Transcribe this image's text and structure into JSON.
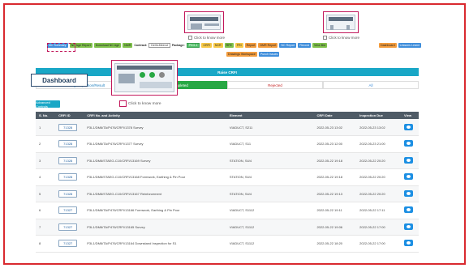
{
  "notes": {
    "click_to_know_more": "Click to know more"
  },
  "callout_label": "Dashboard",
  "toolbar": {
    "buttons_left": [
      "NC Summary",
      "NC Age Report",
      "Download NC Age",
      "NMR"
    ],
    "contract_label": "Contract:",
    "contract_value": "Delhi-Meerut",
    "package_label": "Package:",
    "package_value": "PKG-1",
    "buttons_right": [
      "CRFI",
      "NCR",
      "RFE",
      "FRI",
      "Report",
      "DMR Report",
      "NC Report",
      "Record",
      "View Bid"
    ],
    "buttons_far": [
      "Dashboard",
      "Lessons Learnt"
    ],
    "buttons_row2": [
      "Drawings Workspace",
      "Punch Issues"
    ]
  },
  "raise_title": "Raise CRFI",
  "tabs": [
    "Pending Inspection/Result",
    "Completed",
    "Rejected",
    "All"
  ],
  "advanced_controls": "Advanced Controls",
  "table": {
    "headers": [
      "S. No.",
      "CRFI ID",
      "CRFI No. and Activity",
      "Element",
      "CRFI Date",
      "Inspection Due",
      "View"
    ],
    "rows": [
      {
        "sno": "1",
        "id": "71328",
        "activity": "P3L1/DM6/TA/P476/CRFI/1378 Survey",
        "element": "VIADUCT, S211",
        "date": "2022-05-23 13:02",
        "due": "2022-05-23 13:02"
      },
      {
        "sno": "2",
        "id": "71328",
        "activity": "P3L1/DM6/TA/P476/CRFI/1377 Survey",
        "element": "VIADUCT, S11",
        "date": "2022-05-23 12:00",
        "due": "2022-05-23 21:00"
      },
      {
        "sno": "3",
        "id": "71328",
        "activity": "P3L1/DM6/STAEG-C10/CRFI/13169 Survey",
        "element": "STATION, S4/4",
        "date": "2022-05-22 19:18",
        "due": "2022-05-22 20:20"
      },
      {
        "sno": "4",
        "id": "71328",
        "activity": "P3L1/DM6/STAEG-C10/CRFI/13168 Formwork, Earthing & Pin Pour",
        "element": "STATION, S4/4",
        "date": "2022-05-22 19:18",
        "due": "2022-05-22 20:20"
      },
      {
        "sno": "5",
        "id": "71328",
        "activity": "P3L1/DM6/STAEG-C10/CRFI/13167 Reinforcement",
        "element": "STATION, S4/4",
        "date": "2022-05-22 19:13",
        "due": "2022-05-22 20:20"
      },
      {
        "sno": "6",
        "id": "71327",
        "activity": "P3L1/DM6/TA/P476/CRFI/13166 Formwork, Earthing & Pin Pour",
        "element": "VIADUCT, S1112",
        "date": "2022-05-22 19:11",
        "due": "2022-05-22 17:11"
      },
      {
        "sno": "7",
        "id": "71327",
        "activity": "P3L1/DM6/TA/P476/CRFI/13165 Survey",
        "element": "VIADUCT, S1112",
        "date": "2022-05-22 19:06",
        "due": "2022-05-22 17:00"
      },
      {
        "sno": "8",
        "id": "71327",
        "activity": "P3L1/DM6/TA/P476/CRFI/13164 Downstand Inspection for S1",
        "element": "VIADUCT, S1112",
        "date": "2022-05-22 18:20",
        "due": "2022-05-22 17:00"
      }
    ]
  }
}
